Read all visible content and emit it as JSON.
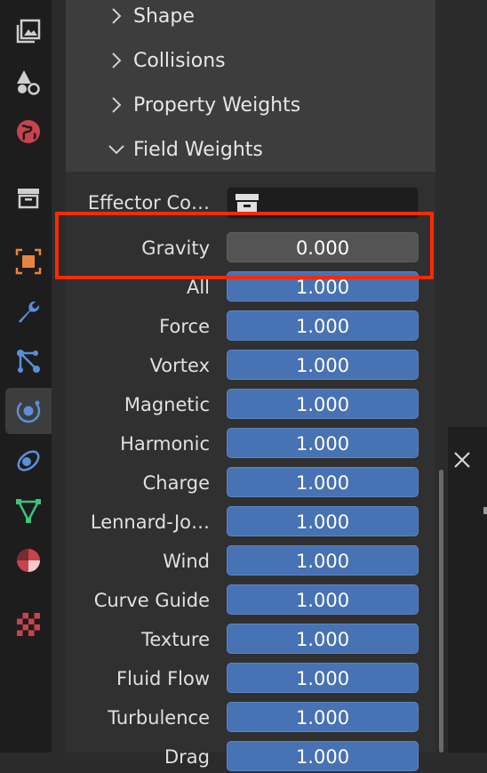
{
  "sidebar": {
    "tabs": [
      {
        "name": "render-layers-icon"
      },
      {
        "name": "scene-icon"
      },
      {
        "name": "world-icon"
      },
      {
        "name": "collection-icon"
      },
      {
        "name": "object-icon"
      },
      {
        "name": "modifier-wrench-icon"
      },
      {
        "name": "particles-icon"
      },
      {
        "name": "physics-icon",
        "active": true
      },
      {
        "name": "constraints-icon"
      },
      {
        "name": "object-data-mesh-icon"
      },
      {
        "name": "material-icon"
      },
      {
        "name": "texture-icon"
      }
    ]
  },
  "subpanels": [
    {
      "label": "Shape",
      "expanded": false
    },
    {
      "label": "Collisions",
      "expanded": false
    },
    {
      "label": "Property Weights",
      "expanded": false
    },
    {
      "label": "Field Weights",
      "expanded": true
    }
  ],
  "field_weights": {
    "effector_collection": {
      "label": "Effector Co…",
      "icon": "collection-icon"
    },
    "rows": [
      {
        "label": "Gravity",
        "value": "0.000"
      },
      {
        "label": "All",
        "value": "1.000"
      },
      {
        "label": "Force",
        "value": "1.000"
      },
      {
        "label": "Vortex",
        "value": "1.000"
      },
      {
        "label": "Magnetic",
        "value": "1.000"
      },
      {
        "label": "Harmonic",
        "value": "1.000"
      },
      {
        "label": "Charge",
        "value": "1.000"
      },
      {
        "label": "Lennard-Jo…",
        "value": "1.000"
      },
      {
        "label": "Wind",
        "value": "1.000"
      },
      {
        "label": "Curve Guide",
        "value": "1.000"
      },
      {
        "label": "Texture",
        "value": "1.000"
      },
      {
        "label": "Fluid Flow",
        "value": "1.000"
      },
      {
        "label": "Turbulence",
        "value": "1.000"
      },
      {
        "label": "Drag",
        "value": "1.000"
      }
    ]
  },
  "colors": {
    "highlight": "#ff2a00",
    "field_blue": "#4772b3",
    "field_grey": "#545454"
  }
}
